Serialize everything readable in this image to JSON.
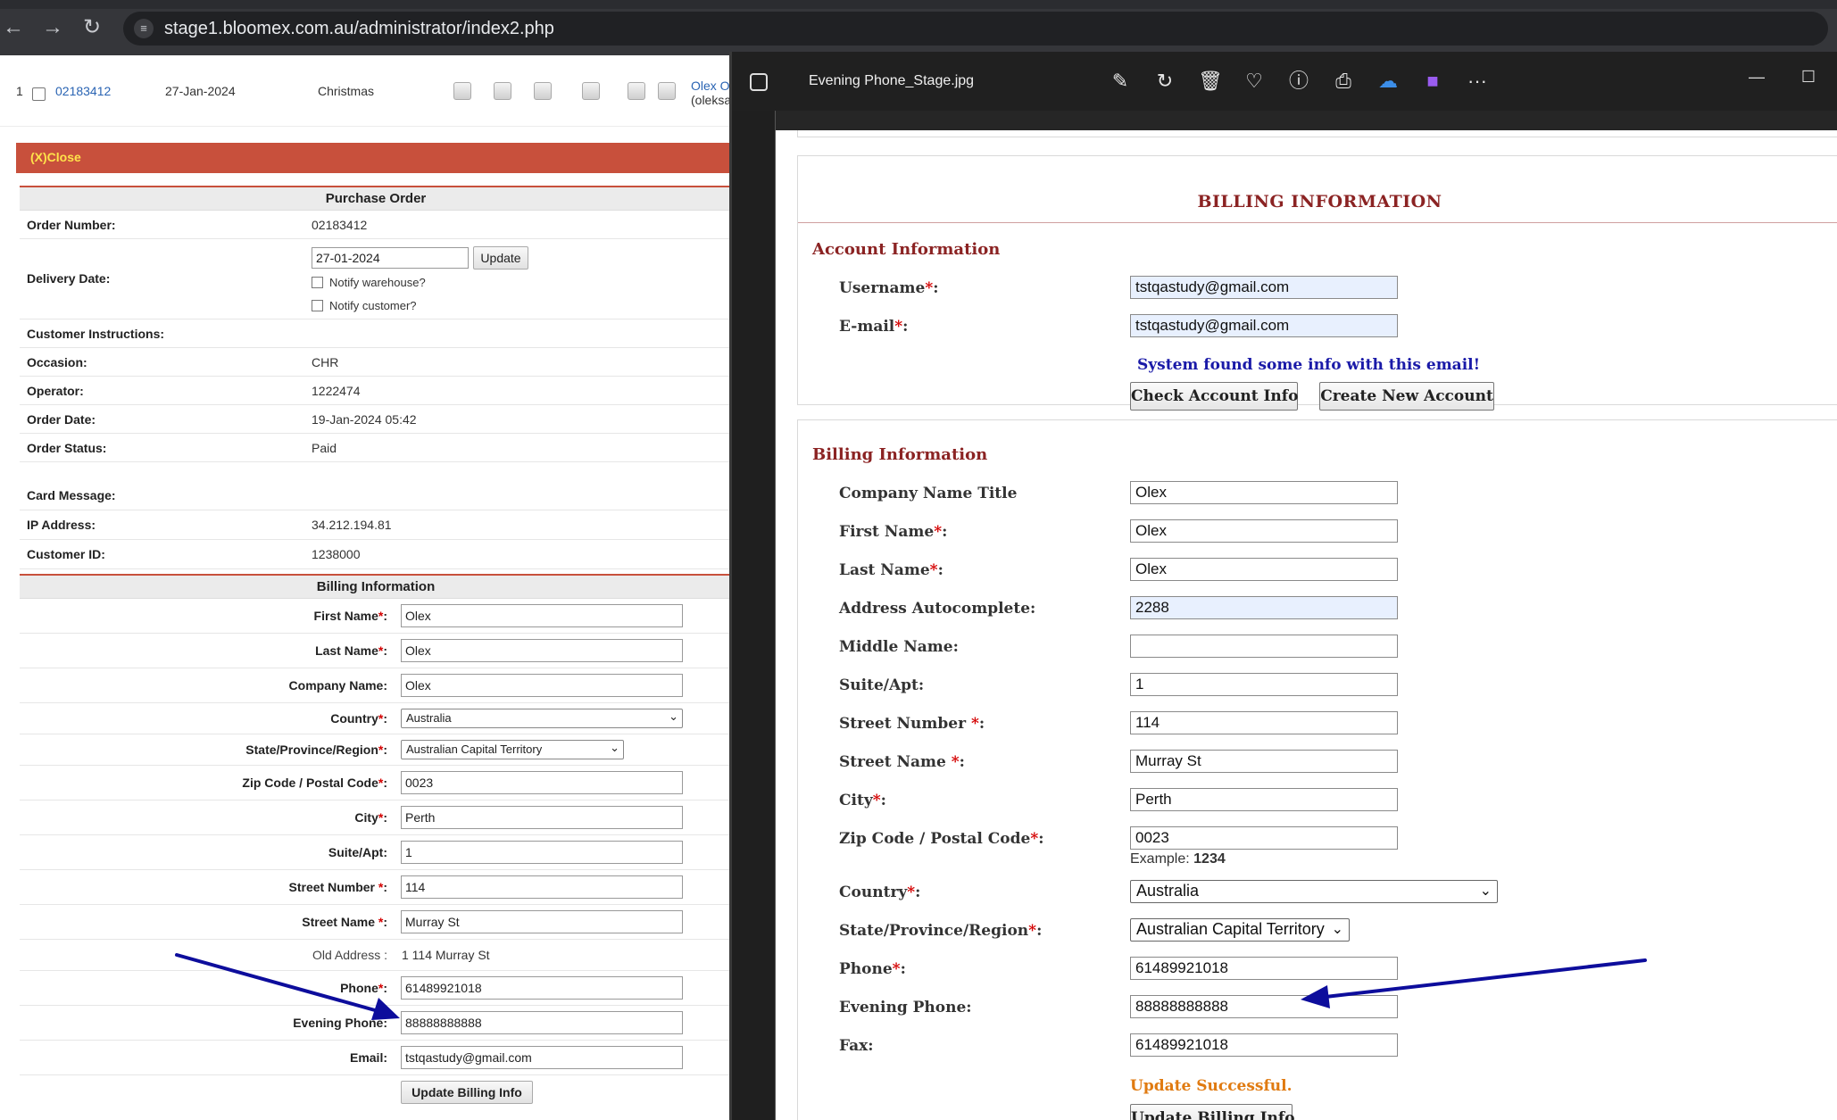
{
  "browser": {
    "url": "stage1.bloomex.com.au/administrator/index2.php"
  },
  "order_row": {
    "index": "1",
    "order_number": "02183412",
    "date": "27-Jan-2024",
    "occasion": "Christmas",
    "customer_name": "Olex O",
    "customer_email": "(oleksa"
  },
  "close_bar": {
    "label": "(X)Close"
  },
  "purchase_order": {
    "title": "Purchase Order",
    "order_number_label": "Order Number:",
    "order_number": "02183412",
    "delivery_date_label": "Delivery Date:",
    "delivery_date_value": "27-01-2024",
    "update_label": "Update",
    "notify_warehouse": "Notify warehouse?",
    "notify_customer": "Notify customer?",
    "customer_instructions_label": "Customer Instructions:",
    "occasion_label": "Occasion:",
    "occasion": "CHR",
    "operator_label": "Operator:",
    "operator": "1222474",
    "order_date_label": "Order Date:",
    "order_date": "19-Jan-2024 05:42",
    "order_status_label": "Order Status:",
    "order_status": "Paid",
    "card_message_label": "Card Message:",
    "ip_address_label": "IP Address:",
    "ip_address": "34.212.194.81",
    "customer_id_label": "Customer ID:",
    "customer_id": "1238000"
  },
  "billing_left": {
    "title": "Billing Information",
    "first_name_label": "First Name",
    "first_name": "Olex",
    "last_name_label": "Last Name",
    "last_name": "Olex",
    "company_name_label": "Company Name:",
    "company_name": "Olex",
    "country_label": "Country",
    "country": "Australia",
    "state_label": "State/Province/Region",
    "state": "Australian Capital Territory",
    "zip_label": "Zip Code / Postal Code",
    "zip": "0023",
    "city_label": "City",
    "city": "Perth",
    "suite_label": "Suite/Apt:",
    "suite": "1",
    "street_number_label": "Street Number ",
    "street_number": "114",
    "street_name_label": "Street Name ",
    "street_name": "Murray St",
    "old_address_label": "Old Address :",
    "old_address": "1 114 Murray St",
    "phone_label": "Phone",
    "phone": "61489921018",
    "evening_phone_label": "Evening Phone:",
    "evening_phone": "88888888888",
    "email_label": "Email:",
    "email": "tstqastudy@gmail.com",
    "update_button": "Update Billing Info",
    "star": "*",
    "colon": ":"
  },
  "viewer": {
    "file_name": "Evening Phone_Stage.jpg",
    "toolbar_icons": [
      "edit-icon",
      "rotate-icon",
      "delete-icon",
      "favorite-icon",
      "info-icon",
      "print-icon",
      "onedrive-icon",
      "clipchamp-icon",
      "more-icon"
    ],
    "more_label": "···",
    "minimize": "—",
    "maximize": "☐"
  },
  "screenshot": {
    "title": "BILLING INFORMATION",
    "account_heading": "Account Information",
    "username_label": "Username",
    "username": "tstqastudy@gmail.com",
    "email_label": "E-mail",
    "email": "tstqastudy@gmail.com",
    "system_msg": "System found some info with this email!",
    "check_account": "Check Account Info",
    "create_account": "Create New Account",
    "billing_heading": "Billing Information",
    "company_label": "Company Name Title",
    "company": "Olex",
    "first_name_label": "First Name",
    "first_name": "Olex",
    "last_name_label": "Last Name",
    "last_name": "Olex",
    "autocomplete_label": "Address Autocomplete:",
    "autocomplete": "2288",
    "middle_label": "Middle Name:",
    "middle": "",
    "suite_label": "Suite/Apt:",
    "suite": "1",
    "street_number_label": "Street Number ",
    "street_number": "114",
    "street_name_label": "Street Name ",
    "street_name": "Murray St",
    "city_label": "City",
    "city": "Perth",
    "zip_label": "Zip Code / Postal Code",
    "zip": "0023",
    "zip_example_prefix": "Example: ",
    "zip_example": "1234",
    "country_label": "Country",
    "country": "Australia",
    "state_label": "State/Province/Region",
    "state": "Australian Capital Territory",
    "phone_label": "Phone",
    "phone": "61489921018",
    "evening_phone_label": "Evening Phone:",
    "evening_phone": "88888888888",
    "fax_label": "Fax:",
    "fax": "61489921018",
    "update_msg": "Update Successful.",
    "update_button": "Update Billing Info",
    "star": "*",
    "colon": ":"
  },
  "colors": {
    "accent_red": "#c8503c",
    "heading_maroon": "#8b2323",
    "arrow_blue": "#0d0d9c",
    "success_orange": "#e07a10",
    "notice_blue": "#1a1aa8"
  }
}
